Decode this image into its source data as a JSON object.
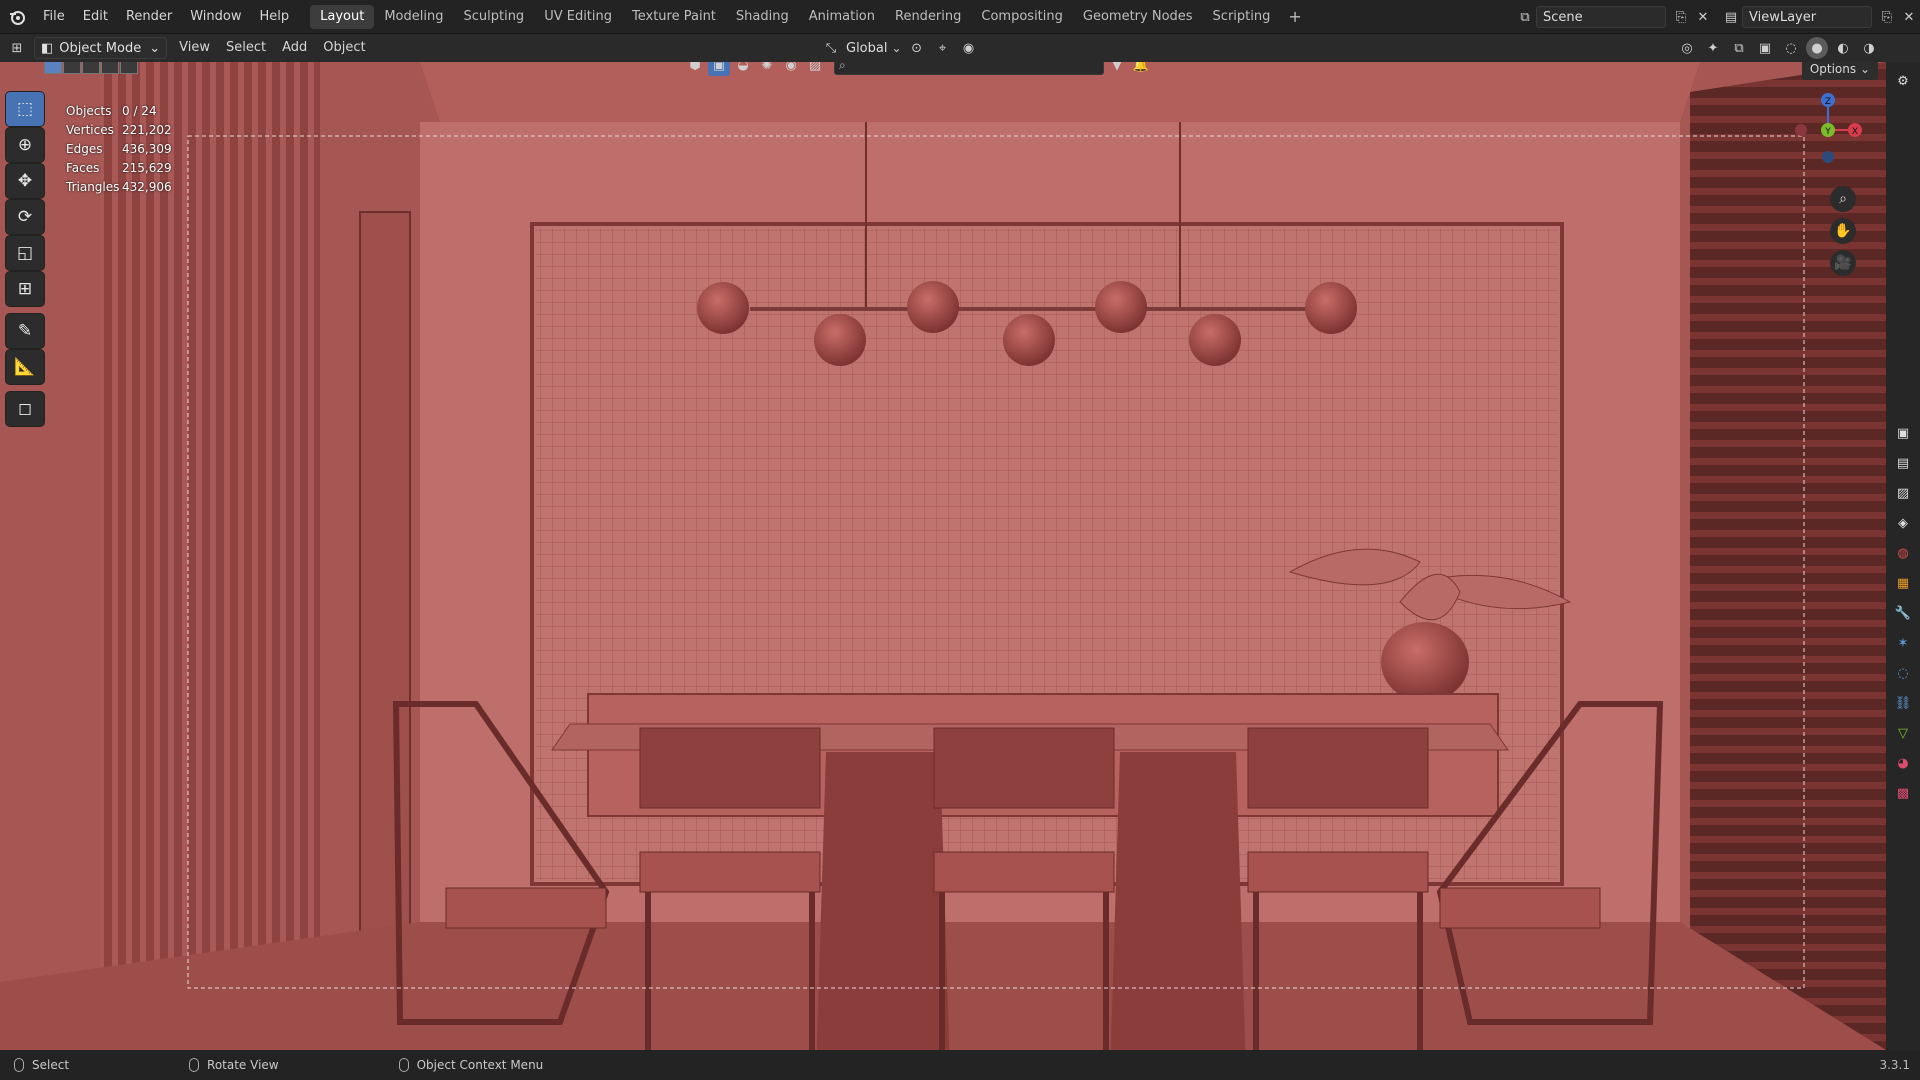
{
  "menu": [
    "File",
    "Edit",
    "Render",
    "Window",
    "Help"
  ],
  "workspaces": [
    "Layout",
    "Modeling",
    "Sculpting",
    "UV Editing",
    "Texture Paint",
    "Shading",
    "Animation",
    "Rendering",
    "Compositing",
    "Geometry Nodes",
    "Scripting"
  ],
  "active_workspace": "Layout",
  "scene": {
    "label": "Scene"
  },
  "view_layer": {
    "label": "ViewLayer"
  },
  "header": {
    "mode": "Object Mode",
    "menus": [
      "View",
      "Select",
      "Add",
      "Object"
    ],
    "orientation": "Global"
  },
  "viewport": {
    "options_label": "Options",
    "stats": [
      {
        "k": "Objects",
        "v": "0 / 24"
      },
      {
        "k": "Vertices",
        "v": "221,202"
      },
      {
        "k": "Edges",
        "v": "436,309"
      },
      {
        "k": "Faces",
        "v": "215,629"
      },
      {
        "k": "Triangles",
        "v": "432,906"
      }
    ],
    "gizmo": {
      "z": "Z",
      "y": "Y",
      "x": "X"
    }
  },
  "status": {
    "select": "Select",
    "rotate": "Rotate View",
    "context": "Object Context Menu",
    "version": "3.3.1"
  },
  "colors": {
    "accent": "#4772b3",
    "scene_bg": "#c97a76",
    "wall": "#b8615e",
    "furniture": "#9c4a47"
  }
}
